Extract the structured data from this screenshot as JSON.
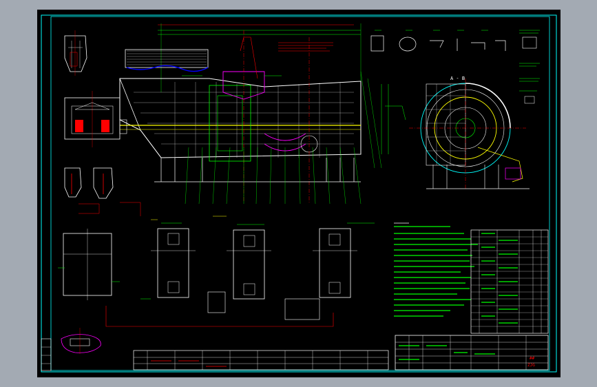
{
  "drawing": {
    "section_label": "A - B",
    "title_block": {
      "title_cell": "##",
      "drawing_no_cell": "ZJG"
    }
  },
  "colors": {
    "background": "#000000",
    "frame": "#00ffff",
    "outline": "#ffffff",
    "centerline": "#ff0000",
    "dimension": "#00ff00",
    "annotation": "#ffff00",
    "highlight": "#ff00ff",
    "hatch": "#0000ff"
  }
}
